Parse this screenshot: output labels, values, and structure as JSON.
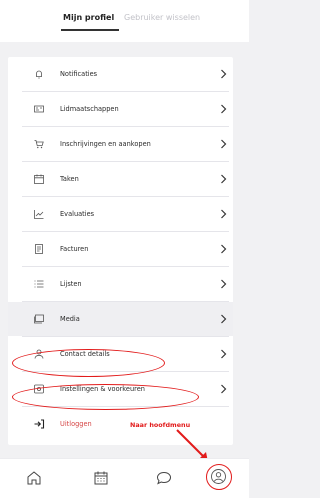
{
  "header": {
    "tabs": [
      {
        "label": "Mijn profiel",
        "active": true
      },
      {
        "label": "Gebruiker wisselen",
        "active": false
      }
    ]
  },
  "menu": {
    "items": [
      {
        "label": "Notificaties",
        "icon": "bell-icon"
      },
      {
        "label": "Lidmaatschappen",
        "icon": "membership-card-icon"
      },
      {
        "label": "Inschrijvingen en aankopen",
        "icon": "cart-icon"
      },
      {
        "label": "Taken",
        "icon": "calendar-icon"
      },
      {
        "label": "Evaluaties",
        "icon": "chart-icon"
      },
      {
        "label": "Facturen",
        "icon": "invoice-icon"
      },
      {
        "label": "Lijsten",
        "icon": "list-icon"
      },
      {
        "label": "Media",
        "icon": "media-icon"
      },
      {
        "label": "Contact details",
        "icon": "user-icon"
      },
      {
        "label": "Instellingen & voorkeuren",
        "icon": "settings-icon"
      },
      {
        "label": "Uitloggen",
        "icon": "logout-icon"
      }
    ]
  },
  "annotation": {
    "text": "Naar hoofdmenu",
    "color": "#e21b1b"
  },
  "bottom_nav": {
    "items": [
      "home-icon",
      "calendar-icon",
      "chat-icon",
      "profile-icon"
    ]
  },
  "colors": {
    "logout_red": "#d64545",
    "annotation_red": "#e21b1b"
  }
}
